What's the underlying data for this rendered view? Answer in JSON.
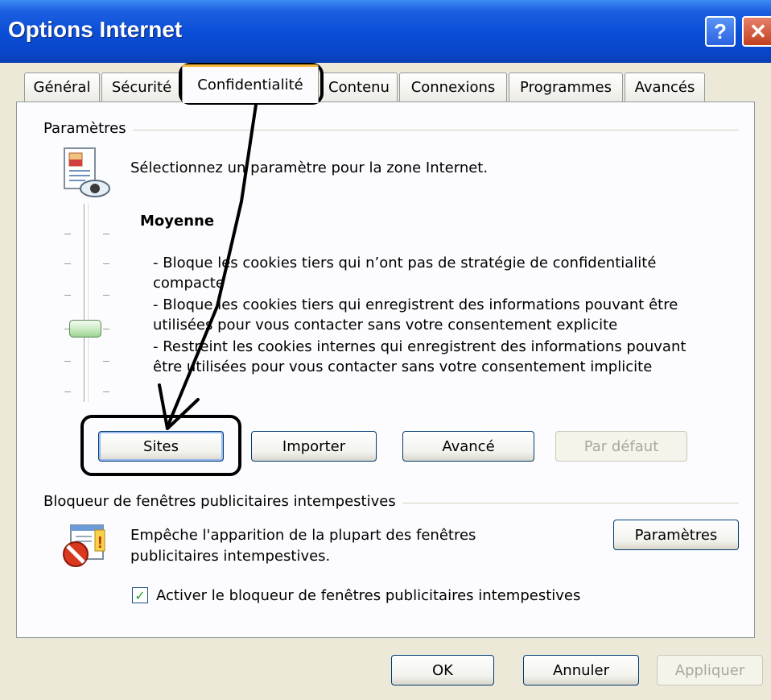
{
  "window": {
    "title": "Options Internet",
    "help_button": "?",
    "close_button": "✕"
  },
  "tabs": [
    {
      "label": "Général"
    },
    {
      "label": "Sécurité"
    },
    {
      "label": "Confidentialité"
    },
    {
      "label": "Contenu"
    },
    {
      "label": "Connexions"
    },
    {
      "label": "Programmes"
    },
    {
      "label": "Avancés"
    }
  ],
  "settings": {
    "group_label": "Paramètres",
    "description": "Sélectionnez un paramètre pour la zone Internet.",
    "level_title": "Moyenne",
    "level_lines": [
      "- Bloque les cookies tiers qui n’ont pas de stratégie de confidentialité",
      "compacte",
      "- Bloque les cookies tiers qui enregistrent des informations pouvant être",
      "utilisées pour vous contacter sans votre consentement explicite",
      "- Restreint les cookies internes qui enregistrent des informations pouvant",
      "être utilisées pour vous contacter sans votre consentement implicite"
    ],
    "buttons": {
      "sites": "Sites",
      "import": "Importer",
      "advanced": "Avancé",
      "default": "Par défaut"
    }
  },
  "popup_blocker": {
    "group_label": "Bloqueur de fenêtres publicitaires intempestives",
    "description_lines": [
      "Empêche l'apparition de la plupart des fenêtres",
      "publicitaires intempestives."
    ],
    "settings_button": "Paramètres",
    "checkbox_label": "Activer le bloqueur de fenêtres publicitaires intempestives",
    "checkbox_checked": true
  },
  "footer": {
    "ok": "OK",
    "cancel": "Annuler",
    "apply": "Appliquer"
  },
  "colors": {
    "titlebar": "#0a4fd8",
    "dialog_bg": "#ece9d8",
    "active_tab_accent": "#f6b73c"
  }
}
